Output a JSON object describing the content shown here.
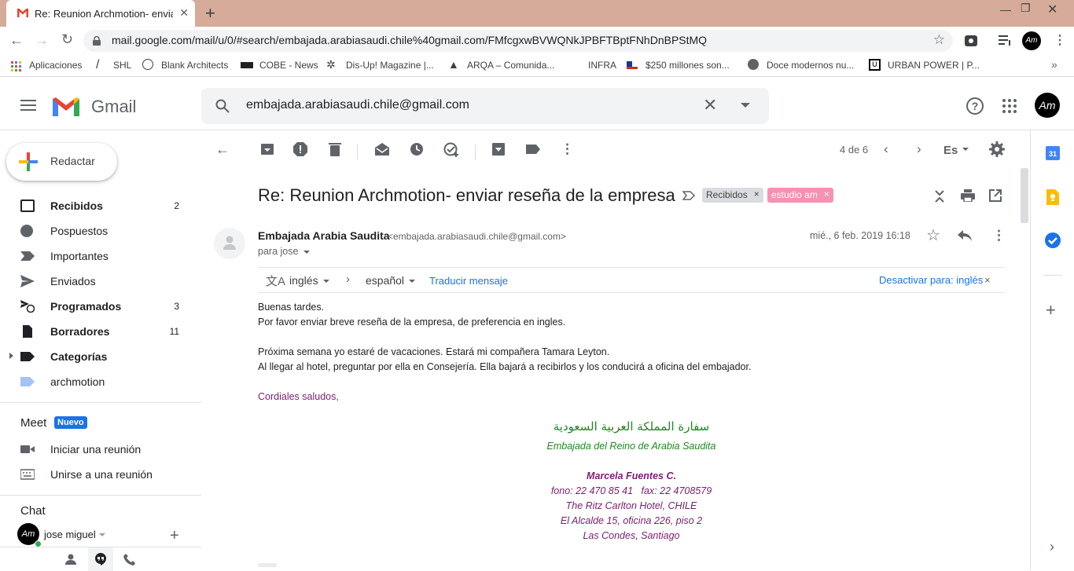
{
  "browser": {
    "tab_title": "Re: Reunion Archmotion- enviar reseña de la empresa",
    "url": "mail.google.com/mail/u/0/#search/embajada.arabiasaudi.chile%40gmail.com/FMfcgxwBVWQNkJPBFTBptFNhDnBPStMQ",
    "bookmarks": [
      "Aplicaciones",
      "SHL",
      "Blank Architects",
      "COBE - News",
      "Dis-Up! Magazine |...",
      "ARQA – Comunida...",
      "INFRA",
      "$250 millones son...",
      "Doce modernos nu...",
      "URBAN POWER | P..."
    ],
    "profile_initials": "Am"
  },
  "gmail": {
    "logo_text": "Gmail",
    "search_value": "embajada.arabiasaudi.chile@gmail.com",
    "compose_label": "Redactar",
    "nav": [
      {
        "label": "Recibidos",
        "count": "2"
      },
      {
        "label": "Pospuestos",
        "count": ""
      },
      {
        "label": "Importantes",
        "count": ""
      },
      {
        "label": "Enviados",
        "count": ""
      },
      {
        "label": "Programados",
        "count": "3"
      },
      {
        "label": "Borradores",
        "count": "11"
      },
      {
        "label": "Categorías",
        "count": ""
      },
      {
        "label": "archmotion",
        "count": ""
      }
    ],
    "meet": {
      "title": "Meet",
      "badge": "Nuevo",
      "start": "Iniciar una reunión",
      "join": "Unirse a una reunión"
    },
    "chat": {
      "title": "Chat",
      "user": "jose miguel"
    },
    "pager": "4 de 6",
    "lang_button": "Es"
  },
  "email": {
    "subject": "Re: Reunion Archmotion- enviar reseña de la empresa",
    "labels": [
      "Recibidos",
      "estudio am"
    ],
    "sender_name": "Embajada Arabia Saudita",
    "sender_email": "<embajada.arabiasaudi.chile@gmail.com>",
    "date": "mié., 6 feb. 2019 16:18",
    "to": "para jose",
    "translate": {
      "from": "inglés",
      "to": "español",
      "action": "Traducir mensaje",
      "disable": "Desactivar para: inglés"
    },
    "body": [
      "Buenas tardes.",
      "Por favor enviar breve reseña de la empresa, de preferencia en ingles.",
      "Próxima semana yo estaré de vacaciones. Estará mi compañera Tamara Leyton.",
      "Al llegar al hotel, preguntar por ella en Consejería. Ella bajará a recibirlos y los conducirá a oficina del embajador.",
      "Cordiales saludos,"
    ],
    "signature": {
      "arabic": "سفارة المملكة العربية السعودية",
      "embassy": "Embajada del Reino de Arabia Saudita",
      "name": "Marcela Fuentes C.",
      "phone": "fono: 22 470 85 41   fax: 22 4708579",
      "hotel": "The Ritz Carlton Hotel, CHILE",
      "address": "El Alcalde 15, oficina 226, piso 2",
      "city": "Las Condes, Santiago"
    }
  },
  "colors": {
    "brand_red": "#ea4335",
    "label_pink": "#f691b2",
    "sig_green": "#1e8a1e",
    "sig_purple": "#7a1f6e",
    "link_blue": "#1a73e8"
  },
  "right_panel": {
    "calendar_day": "31"
  }
}
